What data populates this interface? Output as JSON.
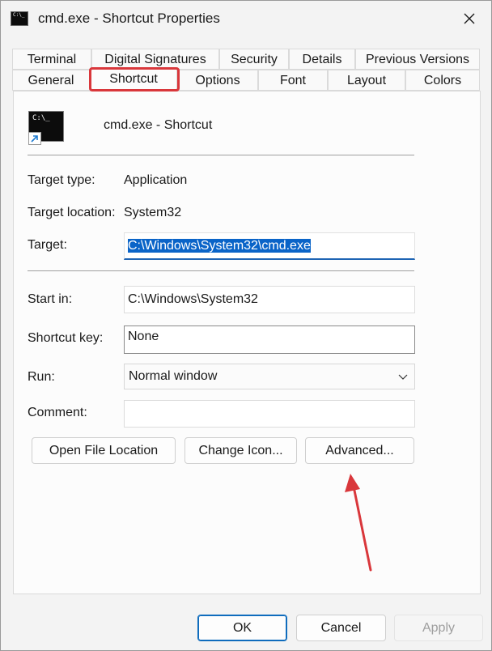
{
  "window": {
    "title": "cmd.exe - Shortcut Properties"
  },
  "tabs": {
    "row1": [
      "Terminal",
      "Digital Signatures",
      "Security",
      "Details",
      "Previous Versions"
    ],
    "row2": [
      "General",
      "Shortcut",
      "Options",
      "Font",
      "Layout",
      "Colors"
    ],
    "selected": "Shortcut"
  },
  "shortcut": {
    "name": "cmd.exe - Shortcut",
    "icon_prompt": "C:\\_",
    "target_type_label": "Target type:",
    "target_type": "Application",
    "target_location_label": "Target location:",
    "target_location": "System32",
    "target_label": "Target:",
    "target": "C:\\Windows\\System32\\cmd.exe",
    "start_in_label": "Start in:",
    "start_in": "C:\\Windows\\System32",
    "shortcut_key_label": "Shortcut key:",
    "shortcut_key": "None",
    "run_label": "Run:",
    "run": "Normal window",
    "comment_label": "Comment:",
    "comment": ""
  },
  "buttons": {
    "open_file_location": "Open File Location",
    "change_icon": "Change Icon...",
    "advanced": "Advanced...",
    "ok": "OK",
    "cancel": "Cancel",
    "apply": "Apply"
  },
  "colors": {
    "accent": "#0f6cbd",
    "highlight": "#d9373b",
    "selection": "#0a64c8"
  },
  "icons": [
    "console-icon",
    "close-icon",
    "shortcut-arrow-icon",
    "chevron-down-icon"
  ]
}
